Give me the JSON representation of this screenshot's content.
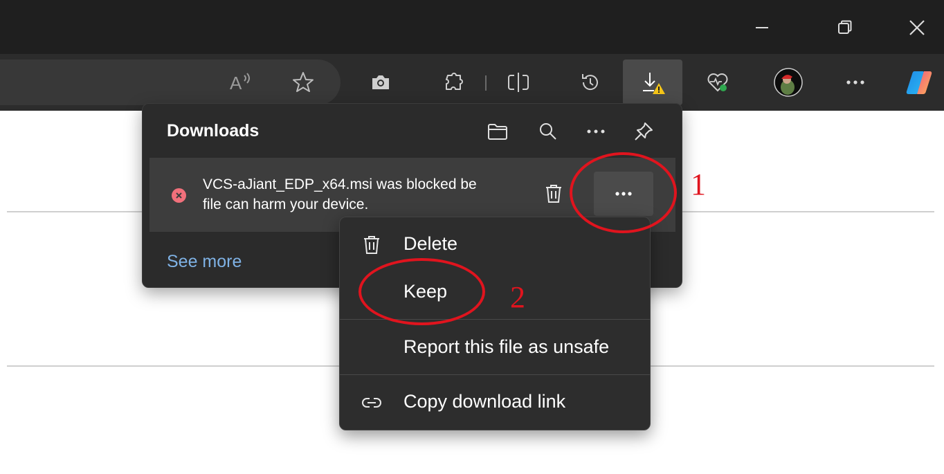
{
  "window_controls": {
    "minimize_icon": "minimize-icon",
    "restore_icon": "restore-icon",
    "close_icon": "close-icon"
  },
  "toolbar": {
    "icons": [
      "read-aloud-icon",
      "favorite-star-icon",
      "screenshot-camera-icon",
      "extensions-icon",
      "split-screen-icon",
      "history-icon",
      "downloads-warning-icon",
      "browser-essentials-icon",
      "profile-avatar",
      "more-icon",
      "copilot-icon"
    ]
  },
  "downloads": {
    "title": "Downloads",
    "header_icons": [
      "open-folder-icon",
      "search-icon",
      "more-options-icon",
      "pin-icon"
    ],
    "item": {
      "line1": "VCS-aJiant_EDP_x64.msi was blocked be",
      "line2": "file can harm your device.",
      "status_color": "#f1707b"
    },
    "see_more": "See more"
  },
  "context_menu": {
    "items": [
      {
        "label": "Delete",
        "icon": "trash-icon"
      },
      {
        "label": "Keep",
        "icon": ""
      },
      {
        "label": "Report this file as unsafe",
        "icon": ""
      },
      {
        "label": "Copy download link",
        "icon": "link-icon"
      }
    ]
  },
  "annotations": {
    "step1": "1",
    "step2": "2",
    "color": "#e0141e"
  }
}
